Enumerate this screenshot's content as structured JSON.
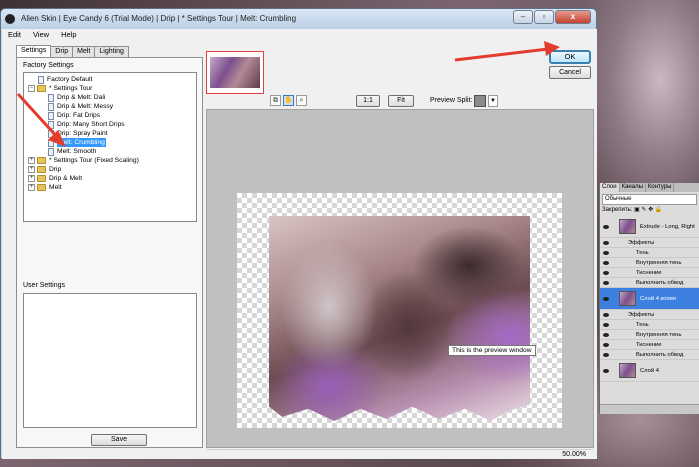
{
  "window": {
    "title": "Alien Skin | Eye Candy 6 (Trial Mode) | Drip | * Settings Tour | Melt: Crumbling",
    "minimize": "–",
    "maximize": "▫",
    "close": "x"
  },
  "menu": [
    "Edit",
    "View",
    "Help"
  ],
  "tabs": [
    "Settings",
    "Drip",
    "Melt",
    "Lighting"
  ],
  "left": {
    "factory_label": "Factory Settings",
    "user_label": "User Settings",
    "save_label": "Save",
    "tree": [
      {
        "label": "Factory Default"
      },
      {
        "label": "* Settings Tour"
      },
      {
        "label": "Drip & Melt: Dali"
      },
      {
        "label": "Drip & Melt: Messy"
      },
      {
        "label": "Drip: Fat Drips"
      },
      {
        "label": "Drip: Many Short Drips"
      },
      {
        "label": "Drip: Spray Paint"
      },
      {
        "label": "Melt: Crumbling"
      },
      {
        "label": "Melt: Smooth"
      },
      {
        "label": "* Settings Tour (Fixed Scaling)"
      },
      {
        "label": "Drip"
      },
      {
        "label": "Drip & Melt"
      },
      {
        "label": "Melt"
      }
    ]
  },
  "toolbar": {
    "zoom_1_1": "1:1",
    "fit": "Fit",
    "preview_split_label": "Preview Split:",
    "ok": "OK",
    "cancel": "Cancel"
  },
  "preview": {
    "tooltip": "This is the preview window",
    "zoom": "50.00%"
  },
  "layers_panel": {
    "tabs": [
      "Слои",
      "Каналы",
      "Контуры"
    ],
    "blend_mode": "Обычные",
    "lock_label": "Закрепить:",
    "rows": [
      {
        "label": "Extrude - Long, Right"
      },
      {
        "label": "Эффекты"
      },
      {
        "label": "Тень"
      },
      {
        "label": "Внутренняя тень"
      },
      {
        "label": "Тиснение"
      },
      {
        "label": "Выполнить обвод"
      },
      {
        "label": "Слой 4 копия"
      },
      {
        "label": "Эффекты"
      },
      {
        "label": "Тень"
      },
      {
        "label": "Внутренняя тень"
      },
      {
        "label": "Тиснение"
      },
      {
        "label": "Выполнить обвод"
      },
      {
        "label": "Слой 4"
      }
    ]
  },
  "colors": {
    "arrow": "#e53b2c",
    "selection": "#3399ff",
    "layer_active": "#3d80df"
  }
}
